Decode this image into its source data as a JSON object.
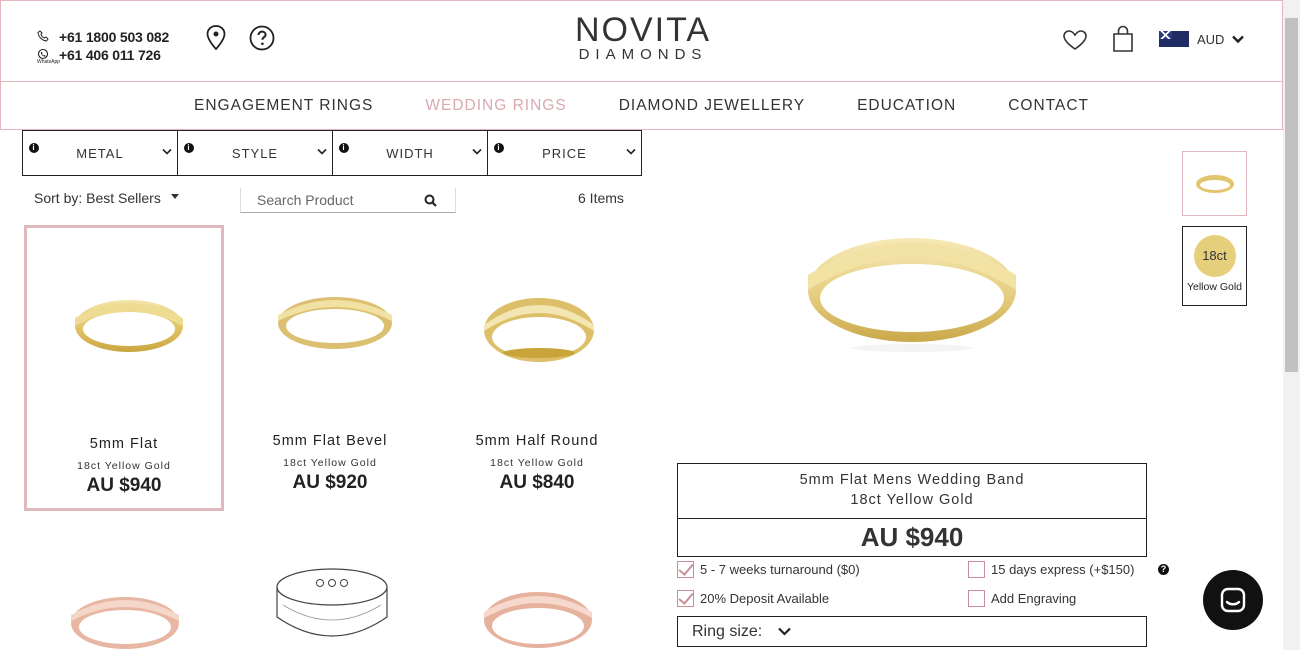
{
  "header": {
    "phones": [
      "+61 1800 503 082",
      "+61 406 011 726"
    ],
    "whatsapp_label": "WhatsApp",
    "logo_line1": "NOVITA",
    "logo_line2": "DIAMONDS",
    "currency": "AUD"
  },
  "nav": {
    "items": [
      "ENGAGEMENT RINGS",
      "WEDDING RINGS",
      "DIAMOND JEWELLERY",
      "EDUCATION",
      "CONTACT"
    ],
    "active": "WEDDING RINGS"
  },
  "filters": [
    "METAL",
    "STYLE",
    "WIDTH",
    "PRICE"
  ],
  "toolbar": {
    "sort_label": "Sort by: Best Sellers",
    "search_placeholder": "Search Product",
    "count": "6 Items"
  },
  "products": [
    {
      "name": "5mm Flat",
      "metal": "18ct Yellow Gold",
      "price": "AU $940"
    },
    {
      "name": "5mm Flat Bevel",
      "metal": "18ct Yellow Gold",
      "price": "AU $920"
    },
    {
      "name": "5mm Half Round",
      "metal": "18ct Yellow Gold",
      "price": "AU $840"
    }
  ],
  "detail": {
    "title": "5mm Flat Mens Wedding Band",
    "metal": "18ct Yellow Gold",
    "price": "AU $940",
    "swatch_karat": "18ct",
    "swatch_label": "Yellow Gold",
    "options": {
      "turnaround": "5 - 7 weeks turnaround ($0)",
      "express": "15 days express (+$150)",
      "deposit": "20% Deposit Available",
      "engraving": "Add Engraving"
    },
    "ring_size_label": "Ring size:"
  },
  "colors": {
    "accent_pink": "#e0b9bf",
    "gold": "#e6cf7b",
    "rose_gold": "#e9b9a4"
  }
}
